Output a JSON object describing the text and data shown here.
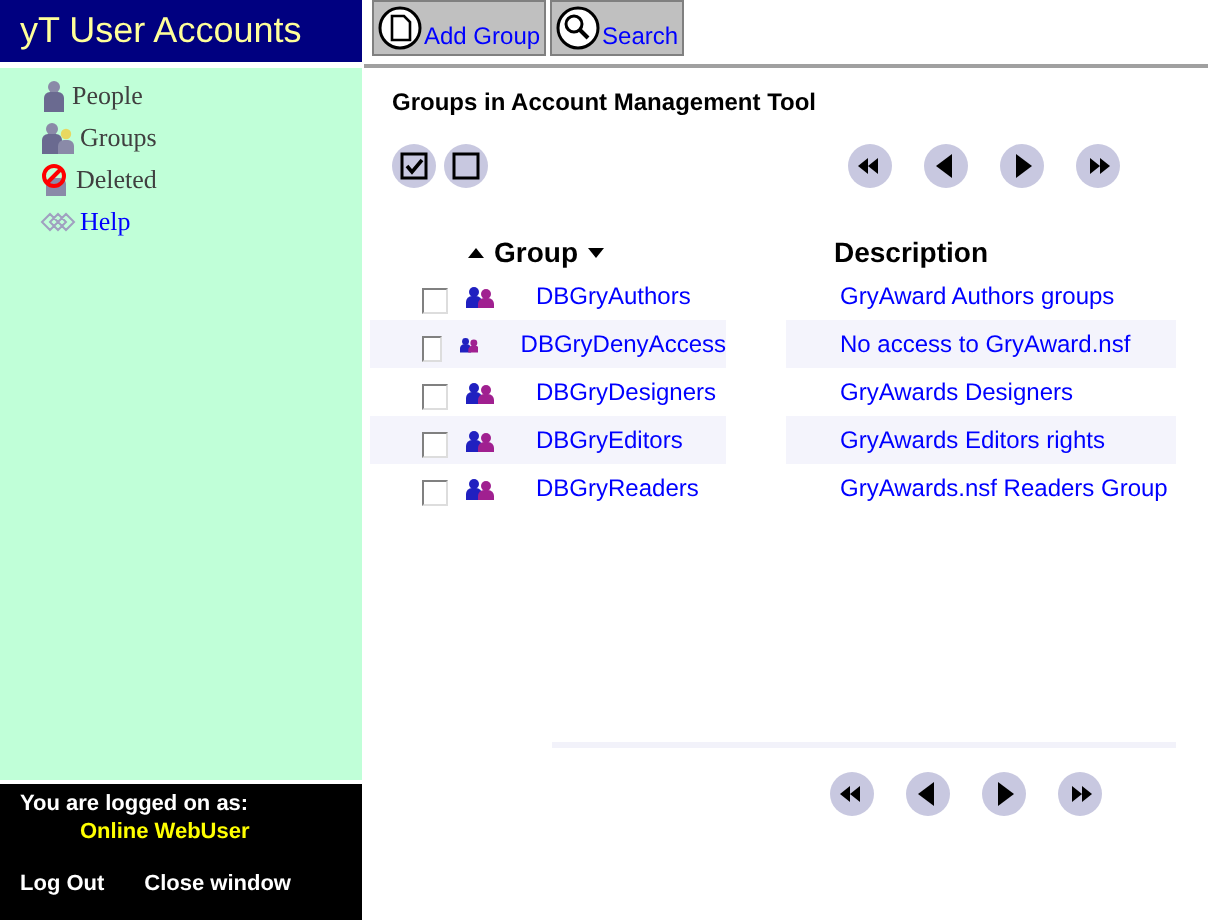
{
  "app_title": "yT User Accounts",
  "nav": [
    {
      "label": "People",
      "kind": "person"
    },
    {
      "label": "Groups",
      "kind": "group"
    },
    {
      "label": "Deleted",
      "kind": "deleted"
    },
    {
      "label": "Help",
      "kind": "help"
    }
  ],
  "toolbar": [
    {
      "label": "Add Group",
      "kind": "add"
    },
    {
      "label": "Search",
      "kind": "search"
    }
  ],
  "view_title": "Groups in Account Management Tool",
  "columns": [
    "Group",
    "Description"
  ],
  "rows": [
    {
      "checked": false,
      "group": "DBGryAuthors",
      "description": "GryAward Authors groups"
    },
    {
      "checked": false,
      "group": "DBGryDenyAccess",
      "description": "No access to GryAward.nsf"
    },
    {
      "checked": false,
      "group": "DBGryDesigners",
      "description": "GryAwards Designers"
    },
    {
      "checked": false,
      "group": "DBGryEditors",
      "description": "GryAwards Editors rights"
    },
    {
      "checked": false,
      "group": "DBGryReaders",
      "description": "GryAwards.nsf Readers Group"
    }
  ],
  "footer": {
    "logged_on_label": "You are logged on as:",
    "user": "Online WebUser",
    "links": [
      "Log Out",
      "Close window"
    ]
  }
}
